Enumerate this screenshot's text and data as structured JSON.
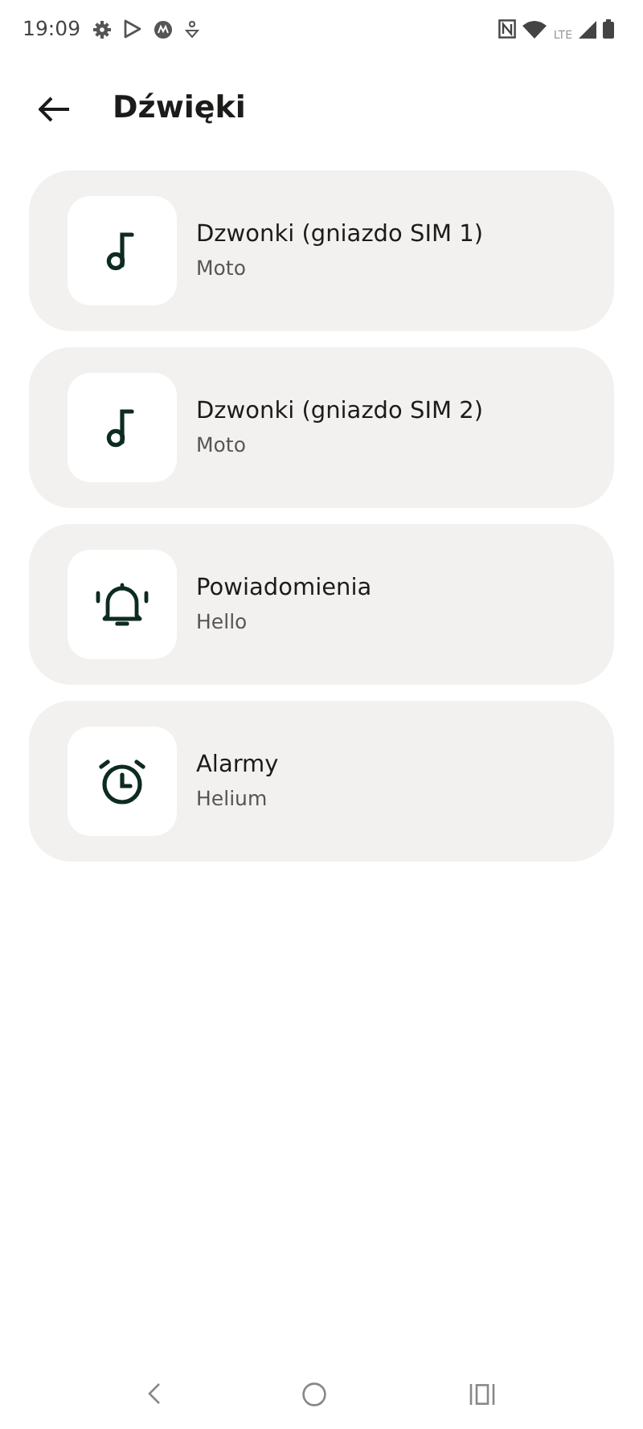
{
  "status_bar": {
    "time": "19:09",
    "network": "LTE"
  },
  "header": {
    "title": "Dźwięki"
  },
  "items": [
    {
      "title": "Dzwonki (gniazdo SIM 1)",
      "subtitle": "Moto",
      "kind": "music"
    },
    {
      "title": "Dzwonki (gniazdo SIM 2)",
      "subtitle": "Moto",
      "kind": "music"
    },
    {
      "title": "Powiadomienia",
      "subtitle": "Hello",
      "kind": "bell"
    },
    {
      "title": "Alarmy",
      "subtitle": "Helium",
      "kind": "alarm"
    }
  ]
}
